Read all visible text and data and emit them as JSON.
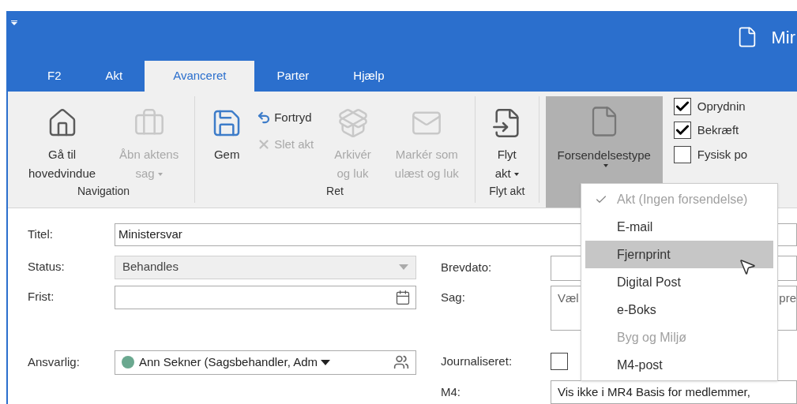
{
  "window": {
    "title": "Mir"
  },
  "tabs": [
    {
      "label": "F2",
      "selected": false
    },
    {
      "label": "Akt",
      "selected": false
    },
    {
      "label": "Avanceret",
      "selected": true
    },
    {
      "label": "Parter",
      "selected": false
    },
    {
      "label": "Hjælp",
      "selected": false
    }
  ],
  "ribbon": {
    "groups": [
      {
        "label": "Navigation",
        "items": [
          {
            "kind": "large",
            "label": "Gå til\nhovedvindue",
            "disabled": false,
            "caret": false
          },
          {
            "kind": "large",
            "label": "Åbn aktens\nsag",
            "disabled": true,
            "caret": true
          }
        ]
      },
      {
        "label": "Ret",
        "items": [
          {
            "kind": "large",
            "label": "Gem",
            "disabled": false,
            "caret": false
          },
          {
            "kind": "small",
            "label": "Fortryd",
            "disabled": false,
            "caret": false
          },
          {
            "kind": "small",
            "label": "Slet akt",
            "disabled": true,
            "caret": false
          },
          {
            "kind": "large",
            "label": "Arkivér\nog luk",
            "disabled": true,
            "caret": false
          },
          {
            "kind": "large",
            "label": "Markér som\nulæst og luk",
            "disabled": true,
            "caret": false
          }
        ]
      },
      {
        "label": "Flyt akt",
        "items": [
          {
            "kind": "large",
            "label": "Flyt\nakt",
            "disabled": false,
            "caret": true
          }
        ]
      }
    ],
    "dispatch": {
      "label": "Forsendelsestype",
      "expanded": true
    },
    "options": [
      {
        "label": "Oprydnin",
        "checked": true
      },
      {
        "label": "Bekræft",
        "checked": true
      },
      {
        "label": "Fysisk po",
        "checked": false
      }
    ]
  },
  "dispatch_menu": [
    {
      "label": "Akt (Ingen forsendelse)",
      "checked": true,
      "disabled": true,
      "selected": false
    },
    {
      "label": "E-mail",
      "checked": false,
      "disabled": false,
      "selected": false
    },
    {
      "label": "Fjernprint",
      "checked": false,
      "disabled": false,
      "selected": true
    },
    {
      "label": "Digital Post",
      "checked": false,
      "disabled": false,
      "selected": false
    },
    {
      "label": "e-Boks",
      "checked": false,
      "disabled": false,
      "selected": false
    },
    {
      "label": "Byg og Miljø",
      "checked": false,
      "disabled": true,
      "selected": false
    },
    {
      "label": "M4-post",
      "checked": false,
      "disabled": false,
      "selected": false
    }
  ],
  "form": {
    "titel": {
      "label": "Titel:",
      "value": "Ministersvar"
    },
    "status": {
      "label": "Status:",
      "value": "Behandles",
      "disabled": true
    },
    "frist": {
      "label": "Frist:"
    },
    "ansvarlig": {
      "label": "Ansvarlig:",
      "value": "Ann Sekner (Sagsbehandler, Adm",
      "color": "#6aa88f"
    },
    "brevdato": {
      "label": "Brevdato:"
    },
    "sag": {
      "label": "Sag:",
      "text_left": "Væl",
      "text_right": "pre"
    },
    "journaliseret": {
      "label": "Journaliseret:",
      "checked": false
    },
    "m4": {
      "label": "M4:",
      "value": "Vis ikke i MR4 Basis for medlemmer,"
    }
  }
}
